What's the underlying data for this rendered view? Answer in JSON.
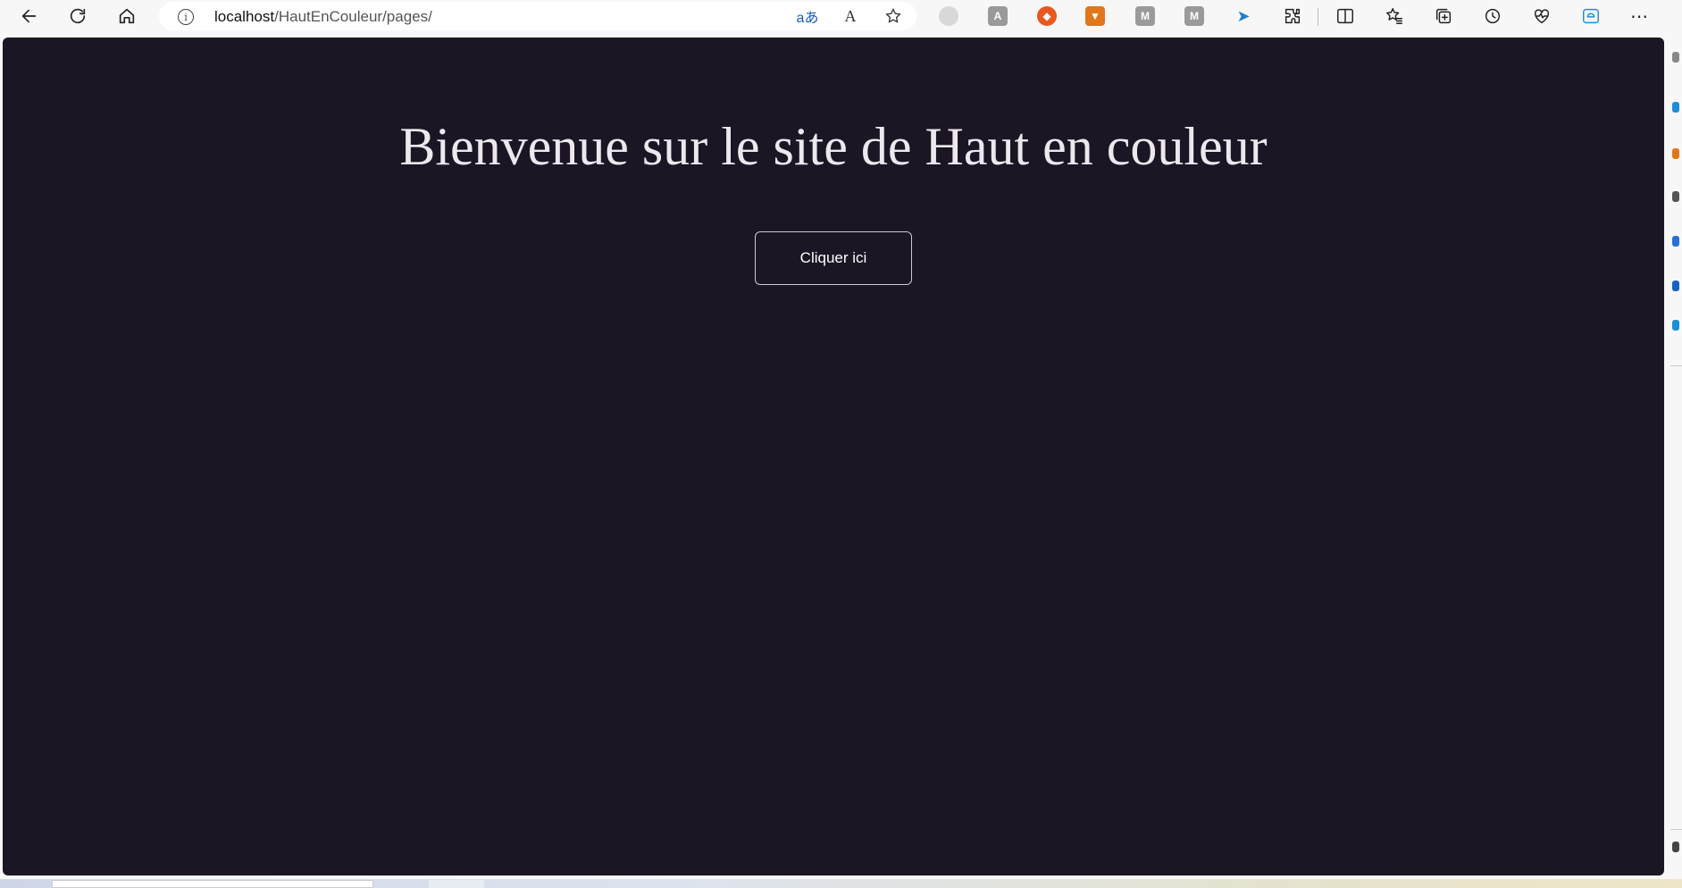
{
  "browser": {
    "url_host": "localhost",
    "url_path": "/HautEnCouleur/pages/",
    "translate_icon_text": "aあ",
    "read_aloud_icon_text": "A",
    "extensions": [
      {
        "name": "ext-grey-circle",
        "color": "#cfcfcf",
        "glyph": "@"
      },
      {
        "name": "ext-font",
        "color": "#9a9a9a",
        "glyph": "A"
      },
      {
        "name": "ext-orange",
        "color": "#e8581f",
        "glyph": "◆"
      },
      {
        "name": "ext-fox",
        "color": "#e2761b",
        "glyph": "🦊"
      },
      {
        "name": "ext-m-1",
        "color": "#9a9a9a",
        "glyph": "M"
      },
      {
        "name": "ext-m-2",
        "color": "#9a9a9a",
        "glyph": "M"
      },
      {
        "name": "ext-blue",
        "color": "#1f7fd6",
        "glyph": "➤"
      }
    ]
  },
  "page": {
    "title": "Bienvenue sur le site de Haut en couleur",
    "cta_label": "Cliquer ici",
    "background_color": "#1c1523"
  }
}
